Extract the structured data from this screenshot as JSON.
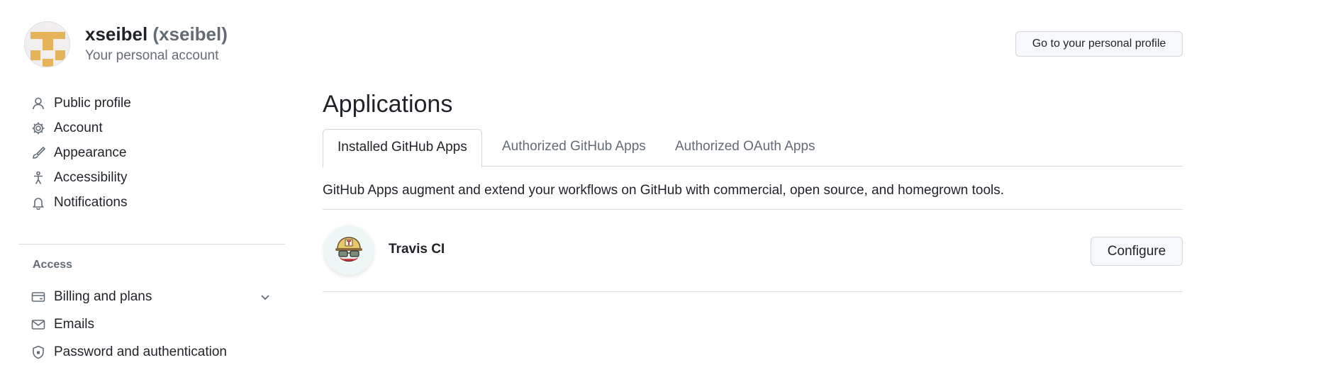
{
  "header": {
    "account_name": "xseibel",
    "account_login": "(xseibel)",
    "account_subtitle": "Your personal account",
    "profile_button": "Go to your personal profile"
  },
  "sidebar": {
    "items": [
      {
        "label": "Public profile",
        "icon": "person-icon"
      },
      {
        "label": "Account",
        "icon": "gear-icon"
      },
      {
        "label": "Appearance",
        "icon": "paintbrush-icon"
      },
      {
        "label": "Accessibility",
        "icon": "accessibility-icon"
      },
      {
        "label": "Notifications",
        "icon": "bell-icon"
      }
    ],
    "access_heading": "Access",
    "access_items": [
      {
        "label": "Billing and plans",
        "icon": "credit-card-icon",
        "expandable": true
      },
      {
        "label": "Emails",
        "icon": "mail-icon"
      },
      {
        "label": "Password and authentication",
        "icon": "shield-lock-icon"
      }
    ]
  },
  "main": {
    "title": "Applications",
    "tabs": [
      {
        "label": "Installed GitHub Apps",
        "selected": true
      },
      {
        "label": "Authorized GitHub Apps",
        "selected": false
      },
      {
        "label": "Authorized OAuth Apps",
        "selected": false
      }
    ],
    "description": "GitHub Apps augment and extend your workflows on GitHub with commercial, open source, and homegrown tools.",
    "apps": [
      {
        "name": "Travis CI",
        "icon": "travis-ci-logo",
        "action": "Configure"
      }
    ]
  },
  "colors": {
    "text_primary": "#1f2328",
    "text_muted": "#636c76",
    "border": "#d0d7de",
    "button_bg": "#f6f8fa",
    "avatar_accent": "#e4b35a"
  }
}
